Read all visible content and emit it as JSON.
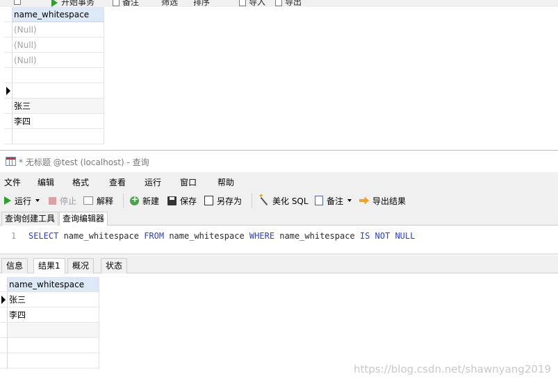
{
  "top_toolbar": {
    "run_label": "开始事务",
    "text_label": "备注",
    "filter_label": "筛选",
    "sort_label": "排序",
    "import_label": "导入",
    "export_label": "导出"
  },
  "top_grid": {
    "column": "name_whitespace",
    "rows": [
      "(Null)",
      "(Null)",
      "(Null)",
      "",
      "",
      "张三",
      "李四",
      ""
    ]
  },
  "window": {
    "title": "* 无标题 @test (localhost) - 查询"
  },
  "menu": [
    "文件",
    "编辑",
    "格式",
    "查看",
    "运行",
    "窗口",
    "帮助"
  ],
  "toolbar": {
    "run": "运行",
    "stop": "停止",
    "explain": "解释",
    "new": "新建",
    "save": "保存",
    "save_as": "另存为",
    "beautify": "美化 SQL",
    "note": "备注",
    "export": "导出结果"
  },
  "editor_tabs": [
    "查询创建工具",
    "查询编辑器"
  ],
  "editor": {
    "line_number": "1",
    "tokens": [
      "SELECT",
      " name_whitespace ",
      "FROM",
      " name_whitespace ",
      "WHERE",
      " name_whitespace ",
      "IS NOT NULL"
    ]
  },
  "result_tabs": [
    "信息",
    "结果1",
    "概况",
    "状态"
  ],
  "result_grid": {
    "column": "name_whitespace",
    "rows": [
      "张三",
      "李四",
      "",
      "",
      ""
    ]
  },
  "watermark": "https://blog.csdn.net/shawnyang2019"
}
